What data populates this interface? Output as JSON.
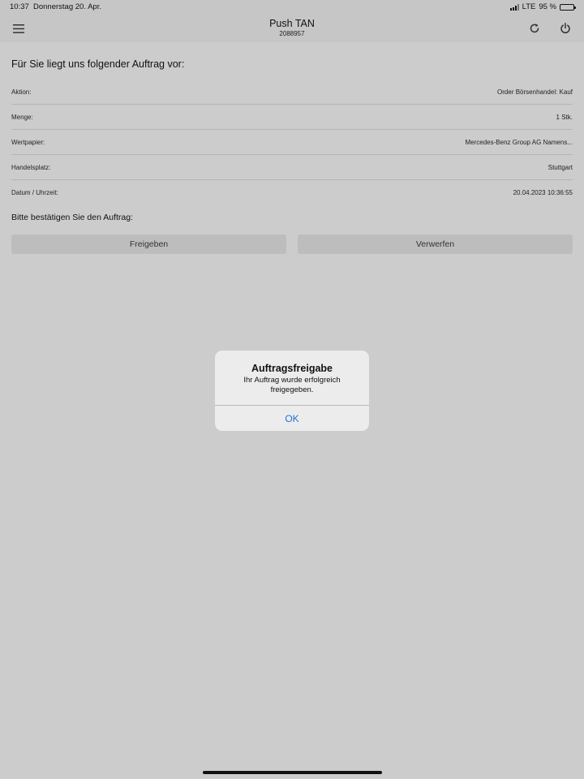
{
  "statusbar": {
    "time": "10:37",
    "date": "Donnerstag 20. Apr.",
    "network": "LTE",
    "battery": "95 %",
    "battery_level": 0.95
  },
  "navbar": {
    "title": "Push TAN",
    "subtitle": "2088957",
    "icons": {
      "menu": "hamburger-menu-icon",
      "refresh": "refresh-icon",
      "logout": "power-icon"
    }
  },
  "order": {
    "headline": "Für Sie liegt uns folgender Auftrag vor:",
    "rows": [
      {
        "label": "Aktion:",
        "value": "Order Börsenhandel: Kauf"
      },
      {
        "label": "Menge:",
        "value": "1 Stk."
      },
      {
        "label": "Wertpapier:",
        "value": "Mercedes-Benz Group AG Namens..."
      },
      {
        "label": "Handelsplatz:",
        "value": "Stuttgart"
      },
      {
        "label": "Datum / Uhrzeit:",
        "value": "20.04.2023 10:36:55"
      }
    ],
    "confirm_prompt": "Bitte bestätigen Sie den Auftrag:",
    "release_label": "Freigeben",
    "reject_label": "Verwerfen"
  },
  "alert": {
    "title": "Auftragsfreigabe",
    "message": "Ihr Auftrag wurde erfolgreich freigegeben.",
    "ok_label": "OK"
  },
  "colors": {
    "background": "#cccccc",
    "bar": "#c6c6c6",
    "button": "#bdbdbd",
    "alert_background": "#ececec",
    "link_blue": "#1f73d6"
  }
}
